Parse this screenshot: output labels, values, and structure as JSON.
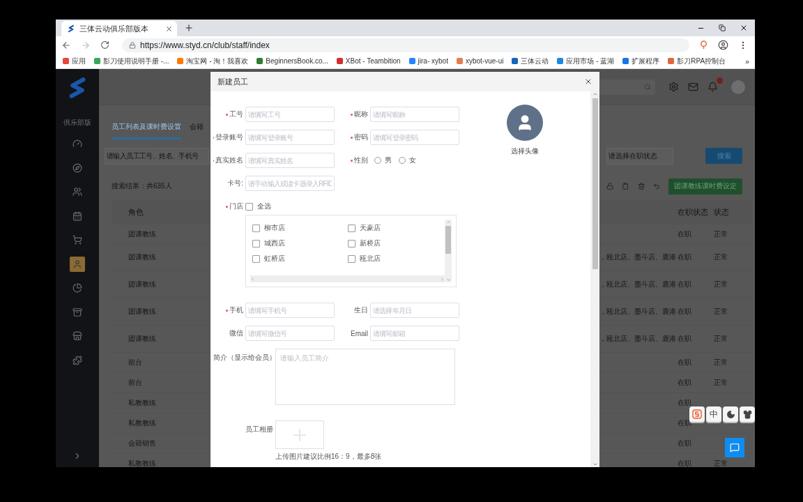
{
  "browser": {
    "tab_title": "三体云动俱乐部版本",
    "url": "https://www.styd.cn/club/staff/index",
    "more": "»",
    "bookmarks": [
      {
        "label": "应用",
        "color": "#e8453c"
      },
      {
        "label": "影刀使用说明手册 -...",
        "color": "#3aa757"
      },
      {
        "label": "淘宝网 - 淘！我喜欢",
        "color": "#ff7a00"
      },
      {
        "label": "BeginnersBook.co...",
        "color": "#2e7d32"
      },
      {
        "label": "XBot - Teambition",
        "color": "#d32f2f"
      },
      {
        "label": "jira- xybot",
        "color": "#2684ff"
      },
      {
        "label": "xybot-vue-ui",
        "color": "#e57d4b"
      },
      {
        "label": "三体云动",
        "color": "#1565c0"
      },
      {
        "label": "应用市场 - 蓝湖",
        "color": "#1e88e5"
      },
      {
        "label": "扩展程序",
        "color": "#1a73e8"
      },
      {
        "label": "影刀RPA控制台",
        "color": "#e0683c"
      }
    ]
  },
  "sidebar": {
    "title": "俱乐部版",
    "items": [
      {
        "selected": false
      },
      {
        "selected": false
      },
      {
        "selected": false
      },
      {
        "selected": false
      },
      {
        "selected": false
      },
      {
        "selected": true
      },
      {
        "selected": false
      },
      {
        "selected": false
      },
      {
        "selected": false
      },
      {
        "selected": false
      }
    ]
  },
  "page": {
    "tabs": [
      {
        "label": "员工列表及课时费设置",
        "selected": true
      },
      {
        "label": "会籍",
        "selected": false
      }
    ],
    "search_placeholder": "请输入员工工号、姓名、手机号",
    "status_placeholder": "请选择在职状态",
    "search_button": "搜索",
    "result_count": "搜索结果：共635人",
    "course_fee_button": "团课教练课时费设定",
    "columns": [
      "角色",
      "在职状态",
      "状态"
    ],
    "rows": [
      {
        "role": "团课教练",
        "employment": "在职",
        "status": "正常"
      },
      {
        "role": "团课教练",
        "stores": "，瓯北店、墨斗店、鹿港",
        "employment": "在职",
        "status": "正常"
      },
      {
        "role": "团课教练",
        "stores": "，瓯北店、墨斗店、鹿港",
        "employment": "在职",
        "status": "正常"
      },
      {
        "role": "团课教练",
        "stores": "，瓯北店、墨斗店、鹿港",
        "employment": "在职",
        "status": "正常"
      },
      {
        "role": "团课教练",
        "stores": "，瓯北店、墨斗店、鹿港",
        "employment": "在职",
        "status": "正常"
      },
      {
        "role": "前台",
        "employment": "在职",
        "status": "正常"
      },
      {
        "role": "前台",
        "employment": "在职",
        "status": "正常"
      },
      {
        "role": "私教教练",
        "employment": "在职"
      },
      {
        "role": "私教教练",
        "employment": "在职"
      },
      {
        "role": "会籍销售",
        "employment": "在职"
      },
      {
        "role": "私教教练",
        "employment": "在职",
        "status": "正常"
      }
    ]
  },
  "ime_toolbar": {
    "language": "中"
  },
  "modal": {
    "title": "新建员工",
    "avatar_label": "选择头像",
    "fields": [
      {
        "kind": "input",
        "label": "工号",
        "placeholder": "请填写工号",
        "required": true
      },
      {
        "kind": "input",
        "label": "昵称",
        "placeholder": "请填写昵称",
        "required": true
      },
      {
        "kind": "input",
        "label": "登录账号",
        "placeholder": "请填写登录账号",
        "required": true
      },
      {
        "kind": "input",
        "label": "密码",
        "placeholder": "请填写登录密码",
        "required": true
      },
      {
        "kind": "input",
        "label": "真实姓名",
        "placeholder": "请填写真实姓名",
        "required": true
      },
      {
        "kind": "radio",
        "label": "性别",
        "required": true,
        "options": [
          {
            "label": "男",
            "selected": false
          },
          {
            "label": "女",
            "selected": false
          }
        ]
      },
      {
        "kind": "input",
        "label": "卡号:",
        "placeholder": "请手动输入或读卡器录入RFID",
        "required": false
      }
    ],
    "stores": {
      "label": "门店",
      "required": true,
      "select_all": {
        "label": "全选",
        "checked": false
      },
      "items": [
        {
          "label": "柳市店",
          "checked": false
        },
        {
          "label": "天豪店",
          "checked": false
        },
        {
          "label": "城西店",
          "checked": false
        },
        {
          "label": "新桥店",
          "checked": false
        },
        {
          "label": "虹桥店",
          "checked": false
        },
        {
          "label": "瓯北店",
          "checked": false
        }
      ]
    },
    "contact_fields": [
      {
        "kind": "input",
        "label": "手机",
        "placeholder": "请填写手机号",
        "required": true
      },
      {
        "kind": "input",
        "label": "生日",
        "placeholder": "请选择年月日",
        "required": false
      },
      {
        "kind": "input",
        "label": "微信",
        "placeholder": "请填写微信号",
        "required": false
      },
      {
        "kind": "input",
        "label": "Email",
        "placeholder": "请填写邮箱",
        "required": false
      }
    ],
    "intro": {
      "label": "简介（显示给会员）",
      "placeholder": "请输入员工简介"
    },
    "album": {
      "label": "员工相册",
      "hint": "上传图片建议比例16：9，最多8张"
    }
  }
}
